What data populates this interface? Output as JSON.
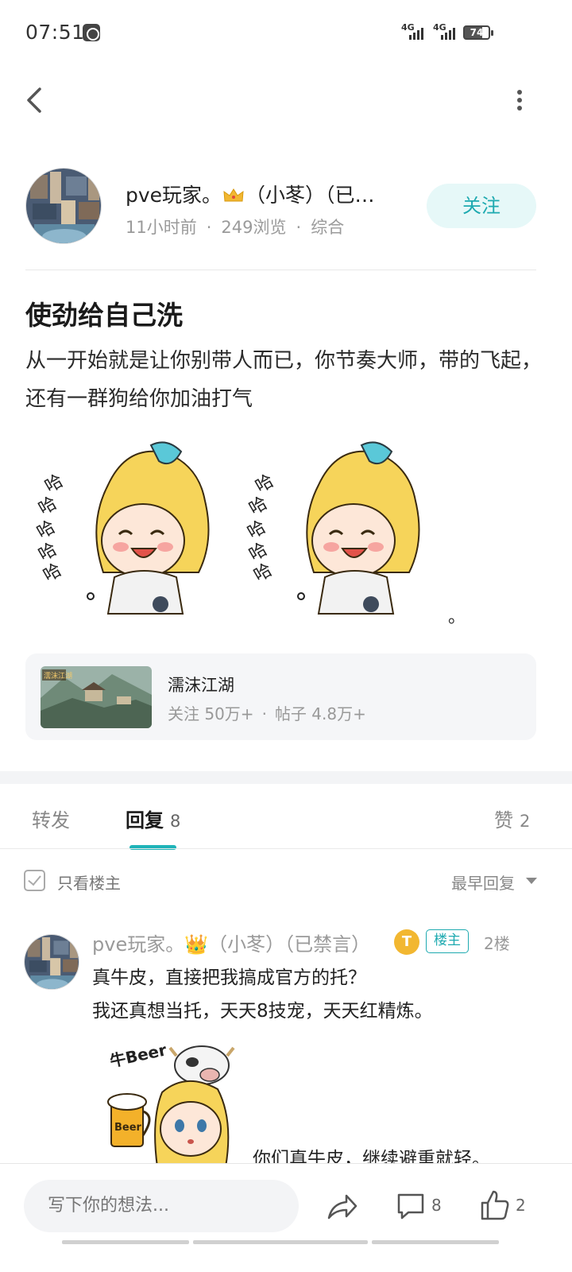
{
  "status_bar": {
    "time": "07:51",
    "network_1": "4G",
    "network_2": "4G",
    "battery": "74"
  },
  "nav": {
    "back_icon": "chevron-left-icon",
    "more_icon": "more-vertical-icon"
  },
  "author": {
    "name_prefix": "pve玩家。",
    "name_suffix": "（小苳）（已…",
    "time_ago": "11小时前",
    "views": "249浏览",
    "category": "综合",
    "follow_label": "关注"
  },
  "post": {
    "title": "使劲给自己洗",
    "body": "从一开始就是让你别带人而已，你节奏大师，带的飞起，还有一群狗给你加油打气",
    "sticker_text": "哈哈哈哈哈…",
    "tail": "。"
  },
  "forum": {
    "thumb_text": "濡沫江湖",
    "name": "濡沫江湖",
    "followers": "关注 50万+",
    "posts": "帖子 4.8万+"
  },
  "tabs": {
    "repost": "转发",
    "reply": "回复",
    "reply_count": "8",
    "like": "赞",
    "like_count": "2"
  },
  "filter": {
    "only_op": "只看楼主",
    "sort": "最早回复"
  },
  "comment": {
    "name": "pve玩家。👑（小苳）（已禁言）",
    "level_badge": "T",
    "op_badge": "楼主",
    "floor": "2楼",
    "line1": "真牛皮，直接把我搞成官方的托？",
    "line2": "我还真想当托，天天8技宠，天天红精炼。",
    "sticker_text_1": "牛Beer",
    "sticker_text_2": "Beer",
    "caption": "你们真牛皮，继续避重就轻。"
  },
  "bottom": {
    "input_placeholder": "写下你的想法...",
    "comment_count": "8",
    "like_count": "2"
  },
  "colors": {
    "accent": "#1eaab0",
    "follow_bg": "#e6f8f8",
    "card_bg": "#f5f6f8",
    "level_badge": "#f2b731"
  }
}
